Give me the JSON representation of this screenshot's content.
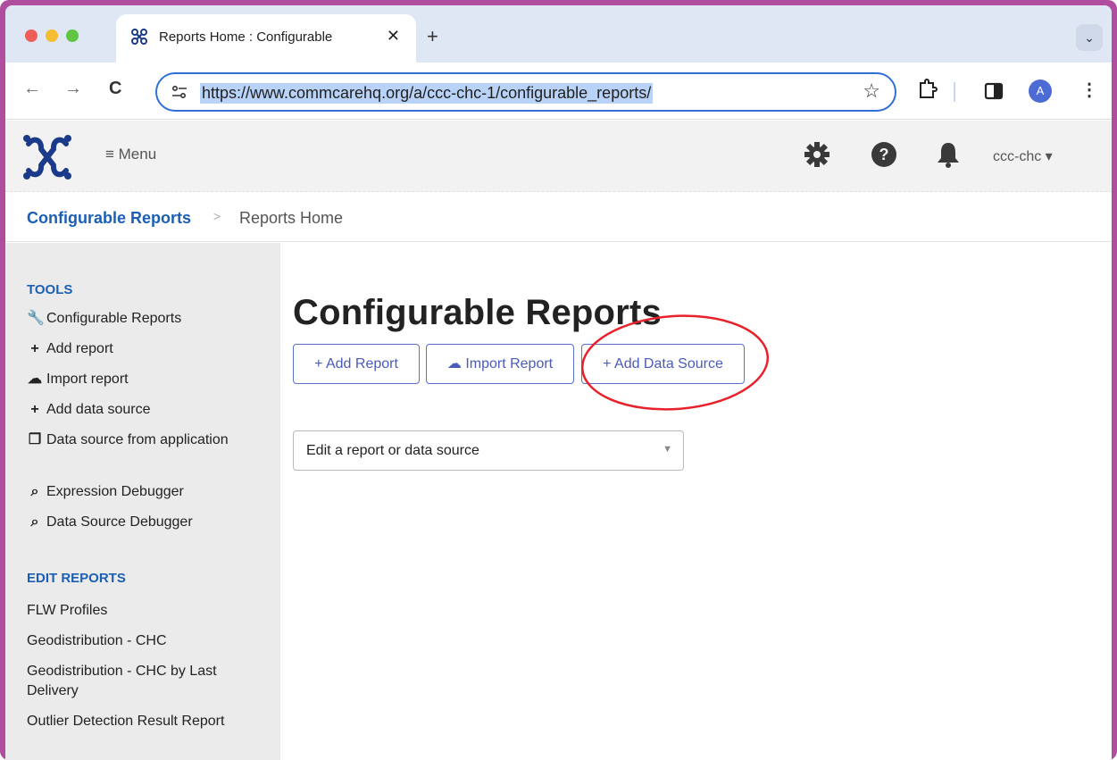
{
  "browser": {
    "tab_title": "Reports Home : Configurable",
    "tab_close": "✕",
    "new_tab": "+",
    "tabs_menu": "⌄",
    "url": "https://www.commcarehq.org/a/ccc-chc-1/configurable_reports/",
    "back": "←",
    "forward": "→",
    "reload": "C",
    "star": "☆",
    "avatar_letter": "A",
    "more": "⋮",
    "favicon_icon": "butterfly-logo-icon",
    "site_info_icon": "tune-icon"
  },
  "header": {
    "menu_label": "≡ Menu",
    "domain": "ccc-chc ▾",
    "icons": [
      "gear-icon",
      "help-icon",
      "bell-icon"
    ]
  },
  "breadcrumb": {
    "parent": "Configurable Reports",
    "separator": ">",
    "current": "Reports Home"
  },
  "sidebar": {
    "tools_heading": "TOOLS",
    "tools": [
      {
        "icon": "wrench-icon",
        "glyph": "🔧",
        "label": "Configurable Reports"
      },
      {
        "icon": "plus-icon",
        "glyph": "+",
        "label": "Add report"
      },
      {
        "icon": "cloud-upload-icon",
        "glyph": "☁",
        "label": "Import report"
      },
      {
        "icon": "plus-icon",
        "glyph": "+",
        "label": "Add data source"
      },
      {
        "icon": "copy-icon",
        "glyph": "❐",
        "label": "Data source from application"
      },
      {
        "icon": "search-icon",
        "glyph": "🔍",
        "label": "Expression Debugger"
      },
      {
        "icon": "search-icon",
        "glyph": "🔍",
        "label": "Data Source Debugger"
      }
    ],
    "edit_heading": "EDIT REPORTS",
    "reports": [
      "FLW Profiles",
      "Geodistribution - CHC",
      "Geodistribution - CHC by Last Delivery",
      "Outlier Detection Result Report"
    ]
  },
  "main": {
    "title": "Configurable Reports",
    "buttons": {
      "add_report": "+ Add Report",
      "import_report": "Import Report",
      "add_data_source": "+ Add Data Source"
    },
    "select_placeholder": "Edit a report or data source"
  },
  "colors": {
    "link_blue": "#1b5fb4",
    "button_blue": "#4a5bb8",
    "annotation_red": "#e8212b",
    "sidebar_bg": "#ebebeb"
  }
}
